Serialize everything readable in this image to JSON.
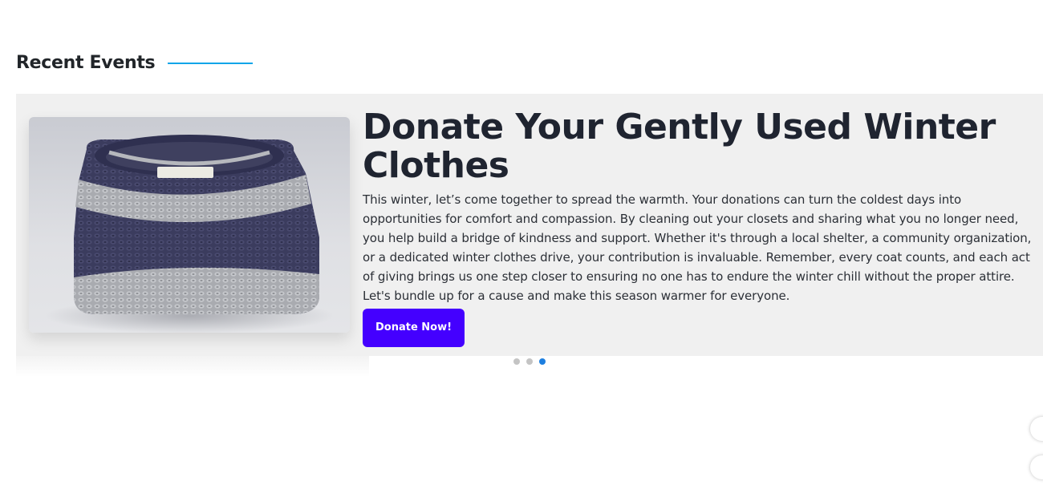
{
  "section": {
    "title": "Recent Events",
    "accent_color": "#0ea5e9"
  },
  "carousel": {
    "active_index": 2,
    "dot_count": 3,
    "slide": {
      "image_alt": "folded striped knit sweater",
      "title": "Donate Your Gently Used Winter Clothes",
      "text": "This winter, let’s come together to spread the warmth. Your donations can turn the coldest days into opportunities for comfort and compassion. By cleaning out your closets and sharing what you no longer need, you help build a bridge of kindness and support. Whether it's through a local shelter, a community organization, or a dedicated winter clothes drive, your contribution is invaluable. Remember, every coat counts, and each act of giving brings us one step closer to ensuring no one has to endure the winter chill without the proper attire. Let's bundle up for a cause and make this season warmer for everyone.",
      "button_label": "Donate Now!",
      "button_color": "#4400ff"
    },
    "dot_colors": {
      "active": "#1d7fe0",
      "inactive": "#c4c4c4"
    }
  }
}
